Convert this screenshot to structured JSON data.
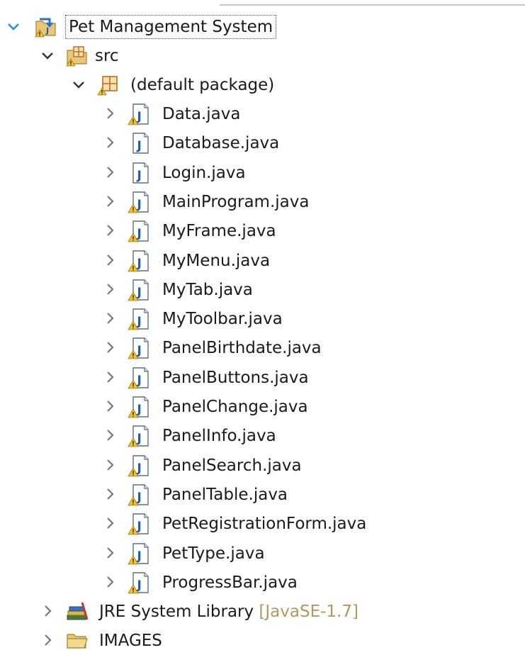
{
  "colors": {
    "expand_blue": "#2a8fd8",
    "chevron_gray": "#777777",
    "java_blue": "#1c5bb8",
    "warning_yellow": "#f2c12e",
    "decoration_gold": "#b0995f",
    "package_orange": "#c26a1a",
    "folder_tan": "#e8c779"
  },
  "project": {
    "label": "Pet Management System",
    "icon": "java-project-icon",
    "expanded": true
  },
  "src": {
    "label": "src",
    "icon": "source-folder-icon",
    "expanded": true
  },
  "package": {
    "label": "(default package)",
    "icon": "package-icon",
    "expanded": true
  },
  "files": [
    {
      "label": "Data.java",
      "warning": true
    },
    {
      "label": "Database.java",
      "warning": false
    },
    {
      "label": "Login.java",
      "warning": false
    },
    {
      "label": "MainProgram.java",
      "warning": true
    },
    {
      "label": "MyFrame.java",
      "warning": true
    },
    {
      "label": "MyMenu.java",
      "warning": true
    },
    {
      "label": "MyTab.java",
      "warning": true
    },
    {
      "label": "MyToolbar.java",
      "warning": true
    },
    {
      "label": "PanelBirthdate.java",
      "warning": true
    },
    {
      "label": "PanelButtons.java",
      "warning": true
    },
    {
      "label": "PanelChange.java",
      "warning": true
    },
    {
      "label": "PanelInfo.java",
      "warning": true
    },
    {
      "label": "PanelSearch.java",
      "warning": true
    },
    {
      "label": "PanelTable.java",
      "warning": true
    },
    {
      "label": "PetRegistrationForm.java",
      "warning": true
    },
    {
      "label": "PetType.java",
      "warning": true
    },
    {
      "label": "ProgressBar.java",
      "warning": true
    }
  ],
  "jre": {
    "label": "JRE System Library",
    "decoration": "[JavaSE-1.7]",
    "icon": "library-icon"
  },
  "images": {
    "label": "IMAGES",
    "icon": "folder-icon"
  }
}
